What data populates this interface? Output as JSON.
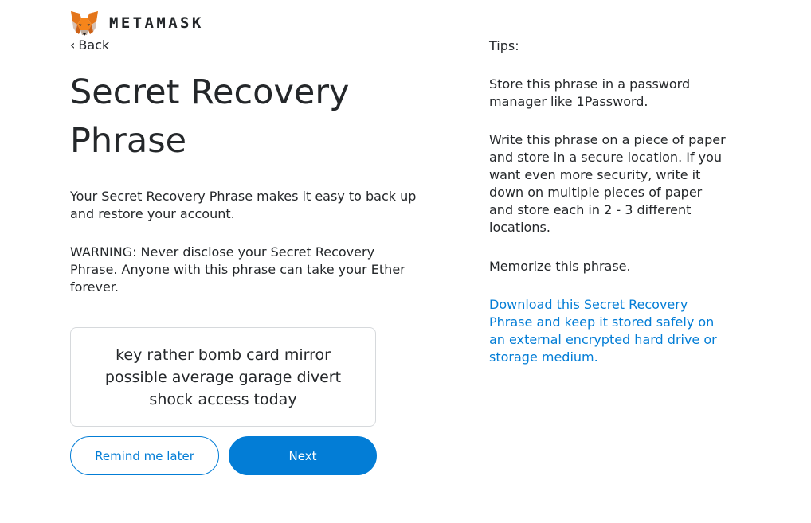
{
  "brand": {
    "wordmark": "METAMASK",
    "logo_icon": "metamask-fox-icon"
  },
  "nav": {
    "back_chevron": "‹",
    "back_label": "Back"
  },
  "main": {
    "title": "Secret Recovery Phrase",
    "description": "Your Secret Recovery Phrase makes it easy to back up and restore your account.",
    "warning": "WARNING: Never disclose your Secret Recovery Phrase. Anyone with this phrase can take your Ether forever.",
    "phrase": "key rather bomb card mirror possible average garage divert shock access today"
  },
  "actions": {
    "remind_label": "Remind me later",
    "next_label": "Next"
  },
  "tips": {
    "heading": "Tips:",
    "items": [
      "Store this phrase in a password manager like 1Password.",
      "Write this phrase on a piece of paper and store in a secure location. If you want even more security, write it down on multiple pieces of paper and store each in 2 - 3 different locations.",
      "Memorize this phrase."
    ],
    "download_link": "Download this Secret Recovery Phrase and keep it stored safely on an external encrypted hard drive or storage medium."
  },
  "colors": {
    "accent": "#037dd6",
    "text": "#24272a",
    "border": "#d6d9dc",
    "fox_orange": "#e2761b"
  }
}
